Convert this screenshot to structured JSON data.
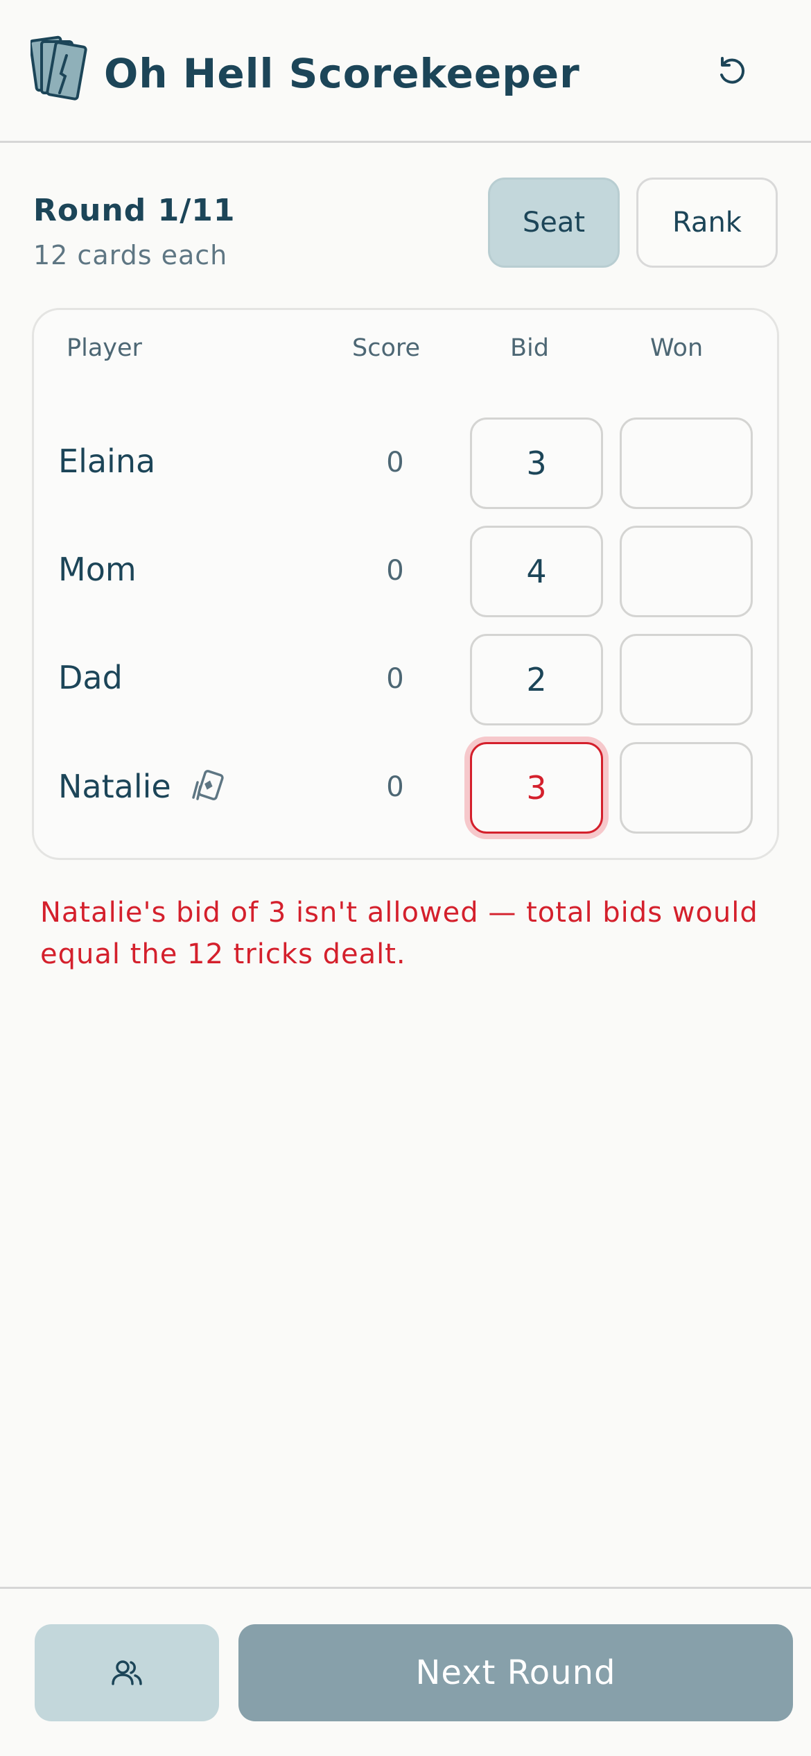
{
  "app": {
    "title": "Oh Hell Scorekeeper"
  },
  "round": {
    "title": "Round 1/11",
    "subtitle": "12 cards each"
  },
  "sort": {
    "seat_label": "Seat",
    "rank_label": "Rank",
    "selected": "Seat"
  },
  "table": {
    "headers": {
      "player": "Player",
      "score": "Score",
      "bid": "Bid",
      "won": "Won"
    },
    "rows": [
      {
        "name": "Elaina",
        "score": "0",
        "bid": "3",
        "won": ""
      },
      {
        "name": "Mom",
        "score": "0",
        "bid": "4",
        "won": ""
      },
      {
        "name": "Dad",
        "score": "0",
        "bid": "2",
        "won": ""
      },
      {
        "name": "Natalie",
        "score": "0",
        "bid": "3",
        "won": "",
        "dealer": true,
        "bid_invalid": true
      }
    ]
  },
  "error": {
    "message": "Natalie's bid of 3 isn't allowed — total bids would equal the 12 tricks dealt."
  },
  "footer": {
    "players_icon": "users-icon",
    "next_label": "Next Round"
  },
  "colors": {
    "primary": "#1c4558",
    "accent_light": "#c3d7db",
    "error": "#d4202c",
    "button_disabled": "#87a0aa"
  }
}
